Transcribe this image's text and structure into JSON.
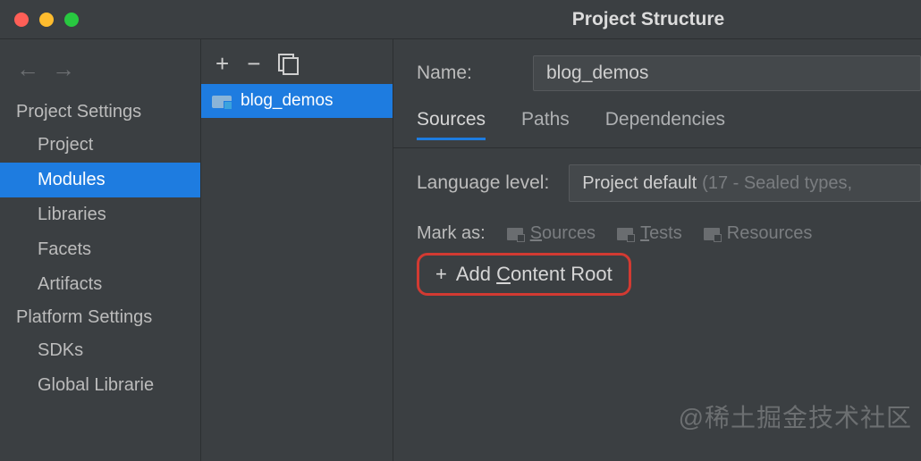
{
  "window": {
    "title": "Project Structure"
  },
  "sidebar": {
    "headers": {
      "project_settings": "Project Settings",
      "platform_settings": "Platform Settings"
    },
    "items": {
      "project": "Project",
      "modules": "Modules",
      "libraries": "Libraries",
      "facets": "Facets",
      "artifacts": "Artifacts",
      "sdks": "SDKs",
      "global_libs": "Global Librarie"
    }
  },
  "modules": {
    "list": [
      {
        "name": "blog_demos"
      }
    ]
  },
  "content": {
    "name_label": "Name:",
    "name_value": "blog_demos",
    "tabs": {
      "sources": "Sources",
      "paths": "Paths",
      "deps": "Dependencies"
    },
    "lang_label": "Language level:",
    "lang_value": "Project default",
    "lang_hint": "(17 - Sealed types,",
    "markas_label": "Mark as:",
    "mark_sources": "Sources",
    "mark_tests": "Tests",
    "mark_resources": "Resources",
    "add_content": "Add Content Root"
  },
  "watermark": "@稀土掘金技术社区"
}
